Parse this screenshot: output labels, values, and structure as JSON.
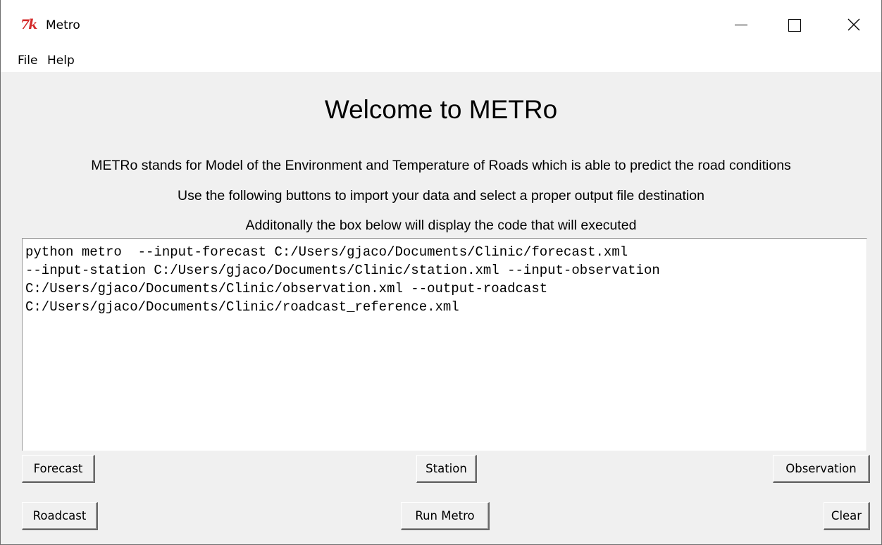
{
  "window": {
    "title": "Metro",
    "app_icon_text": "7k",
    "controls": {
      "minimize": "minimize",
      "maximize": "maximize",
      "close": "close"
    }
  },
  "menu": {
    "items": [
      "File",
      "Help"
    ]
  },
  "main": {
    "heading": "Welcome to METRo",
    "descriptions": [
      "METRo stands for Model of the Environment and Temperature of Roads which is able to predict the road conditions",
      "Use the following buttons to import your data and select a proper output file destination",
      "Additonally the box below will display the code that will executed"
    ],
    "code_lines": [
      "python metro  --input-forecast C:/Users/gjaco/Documents/Clinic/forecast.xml",
      "--input-station C:/Users/gjaco/Documents/Clinic/station.xml --input-observation",
      "C:/Users/gjaco/Documents/Clinic/observation.xml --output-roadcast",
      "C:/Users/gjaco/Documents/Clinic/roadcast_reference.xml"
    ]
  },
  "buttons": {
    "forecast": "Forecast",
    "station": "Station",
    "observation": "Observation",
    "roadcast": "Roadcast",
    "run_metro": "Run Metro",
    "clear": "Clear"
  },
  "colors": {
    "window_bg": "#f0f0f0",
    "titlebar_bg": "#ffffff",
    "icon_red": "#d42a2a"
  }
}
